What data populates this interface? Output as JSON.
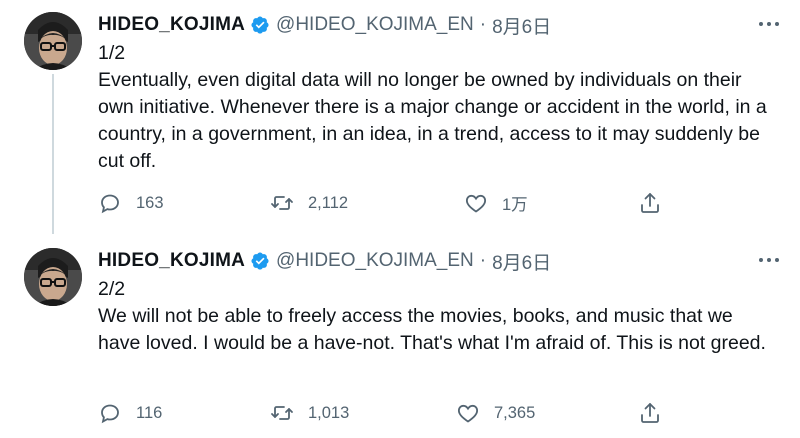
{
  "tweets": [
    {
      "name": "HIDEO_KOJIMA",
      "handle": "@HIDEO_KOJIMA_EN",
      "separator": "·",
      "date": "8月6日",
      "counter": "1/2",
      "text": "Eventually, even digital data will no longer be owned by individuals on their own initiative. Whenever there is a major change or accident in the world, in a country, in a government, in an idea, in a trend, access to it may suddenly be cut off.",
      "replies": "163",
      "retweets": "2,112",
      "likes": "1万"
    },
    {
      "name": "HIDEO_KOJIMA",
      "handle": "@HIDEO_KOJIMA_EN",
      "separator": "·",
      "date": "8月6日",
      "counter": "2/2",
      "text": "We will not be able to freely access the movies, books, and music that we have loved. I would be a have-not. That's what I'm afraid of. This is not greed.",
      "replies": "116",
      "retweets": "1,013",
      "likes": "7,365"
    }
  ],
  "colors": {
    "text": "#0f1419",
    "muted": "#536471",
    "verified": "#1d9bf0",
    "thread_line": "#cfd9de"
  },
  "icons": [
    "verified-badge-icon",
    "more-icon",
    "reply-icon",
    "retweet-icon",
    "like-icon",
    "share-icon"
  ]
}
